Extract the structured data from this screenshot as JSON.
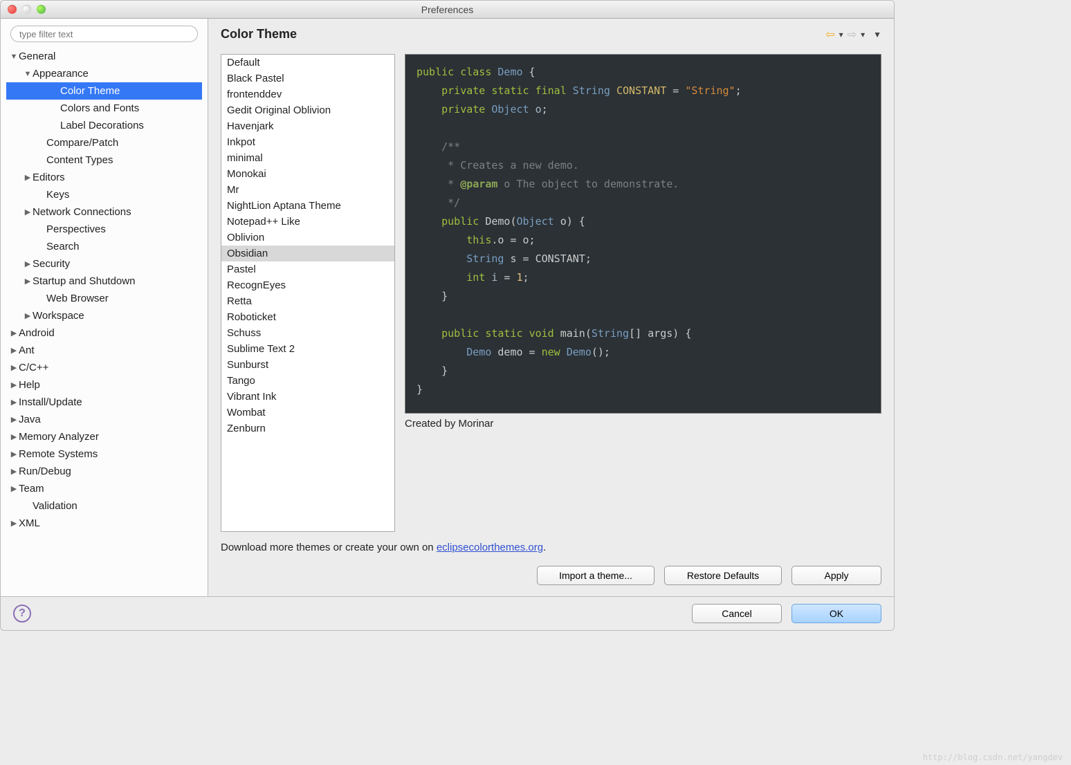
{
  "window": {
    "title": "Preferences"
  },
  "filter": {
    "placeholder": "type filter text"
  },
  "tree": [
    {
      "label": "General",
      "indent": 0,
      "arrow": "down",
      "sel": false
    },
    {
      "label": "Appearance",
      "indent": 1,
      "arrow": "down",
      "sel": false
    },
    {
      "label": "Color Theme",
      "indent": 3,
      "arrow": "",
      "sel": true
    },
    {
      "label": "Colors and Fonts",
      "indent": 3,
      "arrow": "",
      "sel": false
    },
    {
      "label": "Label Decorations",
      "indent": 3,
      "arrow": "",
      "sel": false
    },
    {
      "label": "Compare/Patch",
      "indent": 2,
      "arrow": "",
      "sel": false
    },
    {
      "label": "Content Types",
      "indent": 2,
      "arrow": "",
      "sel": false
    },
    {
      "label": "Editors",
      "indent": 1,
      "arrow": "right",
      "sel": false
    },
    {
      "label": "Keys",
      "indent": 2,
      "arrow": "",
      "sel": false
    },
    {
      "label": "Network Connections",
      "indent": 1,
      "arrow": "right",
      "sel": false
    },
    {
      "label": "Perspectives",
      "indent": 2,
      "arrow": "",
      "sel": false
    },
    {
      "label": "Search",
      "indent": 2,
      "arrow": "",
      "sel": false
    },
    {
      "label": "Security",
      "indent": 1,
      "arrow": "right",
      "sel": false
    },
    {
      "label": "Startup and Shutdown",
      "indent": 1,
      "arrow": "right",
      "sel": false
    },
    {
      "label": "Web Browser",
      "indent": 2,
      "arrow": "",
      "sel": false
    },
    {
      "label": "Workspace",
      "indent": 1,
      "arrow": "right",
      "sel": false
    },
    {
      "label": "Android",
      "indent": 0,
      "arrow": "right",
      "sel": false
    },
    {
      "label": "Ant",
      "indent": 0,
      "arrow": "right",
      "sel": false
    },
    {
      "label": "C/C++",
      "indent": 0,
      "arrow": "right",
      "sel": false
    },
    {
      "label": "Help",
      "indent": 0,
      "arrow": "right",
      "sel": false
    },
    {
      "label": "Install/Update",
      "indent": 0,
      "arrow": "right",
      "sel": false
    },
    {
      "label": "Java",
      "indent": 0,
      "arrow": "right",
      "sel": false
    },
    {
      "label": "Memory Analyzer",
      "indent": 0,
      "arrow": "right",
      "sel": false
    },
    {
      "label": "Remote Systems",
      "indent": 0,
      "arrow": "right",
      "sel": false
    },
    {
      "label": "Run/Debug",
      "indent": 0,
      "arrow": "right",
      "sel": false
    },
    {
      "label": "Team",
      "indent": 0,
      "arrow": "right",
      "sel": false
    },
    {
      "label": "Validation",
      "indent": 1,
      "arrow": "",
      "sel": false
    },
    {
      "label": "XML",
      "indent": 0,
      "arrow": "right",
      "sel": false
    }
  ],
  "page": {
    "title": "Color Theme",
    "credit": "Created by Morinar",
    "download_pre": "Download more themes or create your own on ",
    "download_link": "eclipsecolorthemes.org",
    "download_post": "."
  },
  "themes": [
    "Default",
    "Black Pastel",
    "frontenddev",
    "Gedit Original Oblivion",
    "Havenjark",
    "Inkpot",
    "minimal",
    "Monokai",
    "Mr",
    "NightLion Aptana Theme",
    "Notepad++ Like",
    "Oblivion",
    "Obsidian",
    "Pastel",
    "RecognEyes",
    "Retta",
    "Roboticket",
    "Schuss",
    "Sublime Text 2",
    "Sunburst",
    "Tango",
    "Vibrant Ink",
    "Wombat",
    "Zenburn"
  ],
  "selected_theme": "Obsidian",
  "buttons": {
    "import": "Import a theme...",
    "restore": "Restore Defaults",
    "apply": "Apply",
    "cancel": "Cancel",
    "ok": "OK"
  },
  "watermark": "http://blog.csdn.net/yangdev"
}
